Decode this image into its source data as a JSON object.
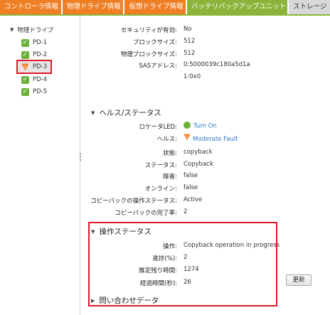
{
  "tabs": [
    {
      "label": "コントローラ情報"
    },
    {
      "label": "物理ドライブ情報"
    },
    {
      "label": "仮想ドライブ情報"
    },
    {
      "label": "バッテリバックアップユニット"
    },
    {
      "label": "ストレージ"
    }
  ],
  "tree": {
    "root_label": "物理ドライブ",
    "items": [
      {
        "label": "PD-1",
        "status": "ok"
      },
      {
        "label": "PD-2",
        "status": "ok"
      },
      {
        "label": "PD-3",
        "status": "warning",
        "selected": true
      },
      {
        "label": "PD-4",
        "status": "ok"
      },
      {
        "label": "PD-5",
        "status": "ok"
      }
    ]
  },
  "properties_top": [
    {
      "label": "セキュリティが有効:",
      "value": "No"
    },
    {
      "label": "ブロックサイズ:",
      "value": "512"
    },
    {
      "label": "物理ブロックサイズ:",
      "value": "512"
    },
    {
      "label": "SASアドレス:",
      "value": "0:5000039c180a5d1a"
    },
    {
      "label": "",
      "value": "1:0x0"
    }
  ],
  "health": {
    "title": "ヘルス/ステータス",
    "locator_led": {
      "label": "ロケータLED:",
      "value": "Turn On"
    },
    "health": {
      "label": "ヘルス:",
      "value": "Moderate Fault"
    },
    "rows": [
      {
        "label": "状態:",
        "value": "copyback"
      },
      {
        "label": "ステータス:",
        "value": "Copyback"
      },
      {
        "label": "障害:",
        "value": "false"
      },
      {
        "label": "オンライン:",
        "value": "false"
      },
      {
        "label": "コピーバックの操作ステータス:",
        "value": "Active"
      },
      {
        "label": "コピーバックの完了率:",
        "value": "2"
      }
    ]
  },
  "operation": {
    "title": "操作ステータス",
    "rows": [
      {
        "label": "操作:",
        "value": "Copyback operation in progress"
      },
      {
        "label": "進捗(%):",
        "value": "2"
      },
      {
        "label": "推定残り時間:",
        "value": "1274"
      },
      {
        "label": "経過時間(秒):",
        "value": "26"
      }
    ]
  },
  "update_button_label": "更新",
  "query_section_title": "問い合わせデータ",
  "colors": {
    "tab_orange": "#ef7f24",
    "tab_green": "#8bb53a",
    "status_ok": "#6bb23b",
    "status_fault": "#ef7f24",
    "highlight_red": "#e0192b",
    "link_blue": "#2b7bc1"
  },
  "icons": {
    "ok_status": "check-icon",
    "drive_warning": "warning-shield-icon",
    "locator_led": "green-dot-icon",
    "health_fault": "warning-shield-icon"
  }
}
